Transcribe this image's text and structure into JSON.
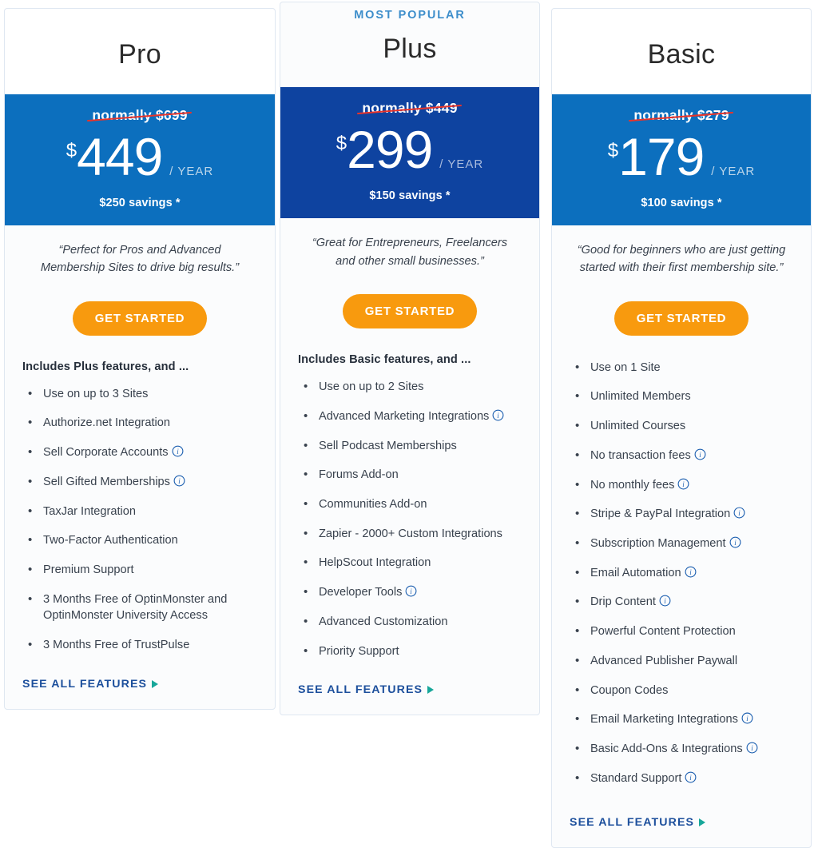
{
  "page": {
    "colors": {
      "band_blue": "#0c6fbe",
      "band_blue_dark": "#0e43a0",
      "cta_orange": "#f89a0e",
      "strike_red": "#e8342a",
      "link_blue": "#1c4f9c",
      "caret_teal": "#17a79a",
      "popular_blue": "#3d8ecb"
    }
  },
  "plans": [
    {
      "id": "pro",
      "badge": "",
      "name": "Pro",
      "normal_price": "normally $699",
      "currency": "$",
      "amount": "449",
      "period": "/ YEAR",
      "savings": "$250 savings *",
      "quote": "“Perfect for Pros and Advanced Membership Sites to drive big results.”",
      "cta_label": "GET STARTED",
      "includes_line": "Includes Plus features, and ...",
      "features": [
        {
          "label": "Use on up to 3 Sites",
          "info": false
        },
        {
          "label": "Authorize.net Integration",
          "info": false
        },
        {
          "label": "Sell Corporate Accounts",
          "info": true
        },
        {
          "label": "Sell Gifted Memberships",
          "info": true
        },
        {
          "label": "TaxJar Integration",
          "info": false
        },
        {
          "label": "Two-Factor Authentication",
          "info": false
        },
        {
          "label": "Premium Support",
          "info": false
        },
        {
          "label": "3 Months Free of OptinMonster and OptinMonster University Access",
          "info": false
        },
        {
          "label": "3 Months Free of TrustPulse",
          "info": false
        }
      ],
      "see_all_label": "SEE ALL FEATURES"
    },
    {
      "id": "plus",
      "badge": "MOST POPULAR",
      "name": "Plus",
      "normal_price": "normally $449",
      "currency": "$",
      "amount": "299",
      "period": "/ YEAR",
      "savings": "$150 savings *",
      "quote": "“Great for Entrepreneurs, Freelancers and other small businesses.”",
      "cta_label": "GET STARTED",
      "includes_line": "Includes Basic features, and ...",
      "features": [
        {
          "label": "Use on up to 2 Sites",
          "info": false
        },
        {
          "label": "Advanced Marketing Integrations",
          "info": true
        },
        {
          "label": "Sell Podcast Memberships",
          "info": false
        },
        {
          "label": "Forums Add-on",
          "info": false
        },
        {
          "label": "Communities Add-on",
          "info": false
        },
        {
          "label": "Zapier - 2000+ Custom Integrations",
          "info": false
        },
        {
          "label": "HelpScout Integration",
          "info": false
        },
        {
          "label": "Developer Tools",
          "info": true
        },
        {
          "label": "Advanced Customization",
          "info": false
        },
        {
          "label": "Priority Support",
          "info": false
        }
      ],
      "see_all_label": "SEE ALL FEATURES"
    },
    {
      "id": "basic",
      "badge": "",
      "name": "Basic",
      "normal_price": "normally $279",
      "currency": "$",
      "amount": "179",
      "period": "/ YEAR",
      "savings": "$100 savings *",
      "quote": "“Good for beginners who are just getting started with their first membership site.”",
      "cta_label": "GET STARTED",
      "includes_line": "",
      "features": [
        {
          "label": "Use on 1 Site",
          "info": false
        },
        {
          "label": "Unlimited Members",
          "info": false
        },
        {
          "label": "Unlimited Courses",
          "info": false
        },
        {
          "label": "No transaction fees",
          "info": true
        },
        {
          "label": "No monthly fees",
          "info": true
        },
        {
          "label": "Stripe & PayPal Integration",
          "info": true
        },
        {
          "label": "Subscription Management",
          "info": true
        },
        {
          "label": "Email Automation",
          "info": true
        },
        {
          "label": "Drip Content",
          "info": true
        },
        {
          "label": "Powerful Content Protection",
          "info": false
        },
        {
          "label": "Advanced Publisher Paywall",
          "info": false
        },
        {
          "label": "Coupon Codes",
          "info": false
        },
        {
          "label": "Email Marketing Integrations",
          "info": true
        },
        {
          "label": "Basic Add-Ons & Integrations",
          "info": true
        },
        {
          "label": "Standard Support",
          "info": true
        }
      ],
      "see_all_label": "SEE ALL FEATURES"
    }
  ]
}
